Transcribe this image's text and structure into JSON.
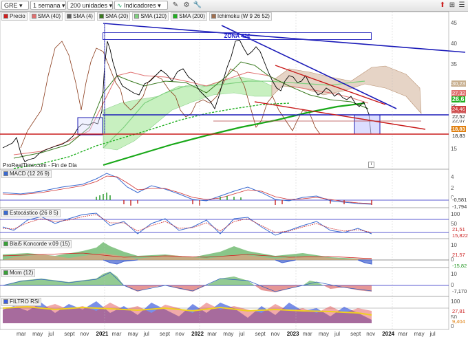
{
  "toolbar": {
    "symbol": "GRE",
    "period": "1 semana",
    "units": "200 unidades",
    "indicators": "Indicadores"
  },
  "main_legend": [
    {
      "label": "Precio",
      "color": "#d02020"
    },
    {
      "label": "SMA (40)",
      "color": "#e07070"
    },
    {
      "label": "SMA (4)",
      "color": "#606060"
    },
    {
      "label": "SMA (20)",
      "color": "#3a7a20"
    },
    {
      "label": "SMA (120)",
      "color": "#7fd07f"
    },
    {
      "label": "SMA (200)",
      "color": "#22b022"
    },
    {
      "label": "Ichimoku (W 9 26 52)",
      "color": "#a07050"
    }
  ],
  "zone_label": "ZONA 42€",
  "watermark": "ProRealTime.com - Fin de Día",
  "price_axis": [
    "45",
    "40",
    "35",
    "30",
    "25",
    "20",
    "15"
  ],
  "price_tags": [
    "30,23",
    "27,32",
    "26,6",
    "24,46",
    "23,35",
    "22,07",
    "22,52",
    "18,83",
    "18,83"
  ],
  "panels": [
    {
      "label": "MACD (12 26 9)",
      "ticks": [
        "4",
        "2",
        "0"
      ],
      "tags": [
        "-0,581",
        "-1,794"
      ]
    },
    {
      "label": "Estocástico (26 8 5)",
      "ticks": [
        "100",
        "50",
        "0"
      ],
      "tags": [
        "21,51",
        "15,822"
      ]
    },
    {
      "label": "Blai5 Koncorde v.09 (15)",
      "ticks": [
        "10",
        "0"
      ],
      "tags": [
        "21,57",
        "-15,82"
      ]
    },
    {
      "label": "Mom (12)",
      "ticks": [
        "10",
        "0"
      ],
      "tags": [
        "-7,170"
      ]
    },
    {
      "label": "FILTRO RSI",
      "ticks": [
        "100",
        "50",
        "0"
      ],
      "tags": [
        "27,81",
        "9,404"
      ]
    }
  ],
  "x_axis": [
    {
      "label": "mar",
      "year": false
    },
    {
      "label": "may",
      "year": false
    },
    {
      "label": "jul",
      "year": false
    },
    {
      "label": "sept",
      "year": false
    },
    {
      "label": "nov",
      "year": false
    },
    {
      "label": "2021",
      "year": true
    },
    {
      "label": "mar",
      "year": false
    },
    {
      "label": "may",
      "year": false
    },
    {
      "label": "jul",
      "year": false
    },
    {
      "label": "sept",
      "year": false
    },
    {
      "label": "nov",
      "year": false
    },
    {
      "label": "2022",
      "year": true
    },
    {
      "label": "mar",
      "year": false
    },
    {
      "label": "may",
      "year": false
    },
    {
      "label": "jul",
      "year": false
    },
    {
      "label": "sept",
      "year": false
    },
    {
      "label": "nov",
      "year": false
    },
    {
      "label": "2023",
      "year": true
    },
    {
      "label": "mar",
      "year": false
    },
    {
      "label": "may",
      "year": false
    },
    {
      "label": "jul",
      "year": false
    },
    {
      "label": "sept",
      "year": false
    },
    {
      "label": "nov",
      "year": false
    },
    {
      "label": "2024",
      "year": true
    },
    {
      "label": "mar",
      "year": false
    },
    {
      "label": "may",
      "year": false
    },
    {
      "label": "jul",
      "year": false
    }
  ]
}
